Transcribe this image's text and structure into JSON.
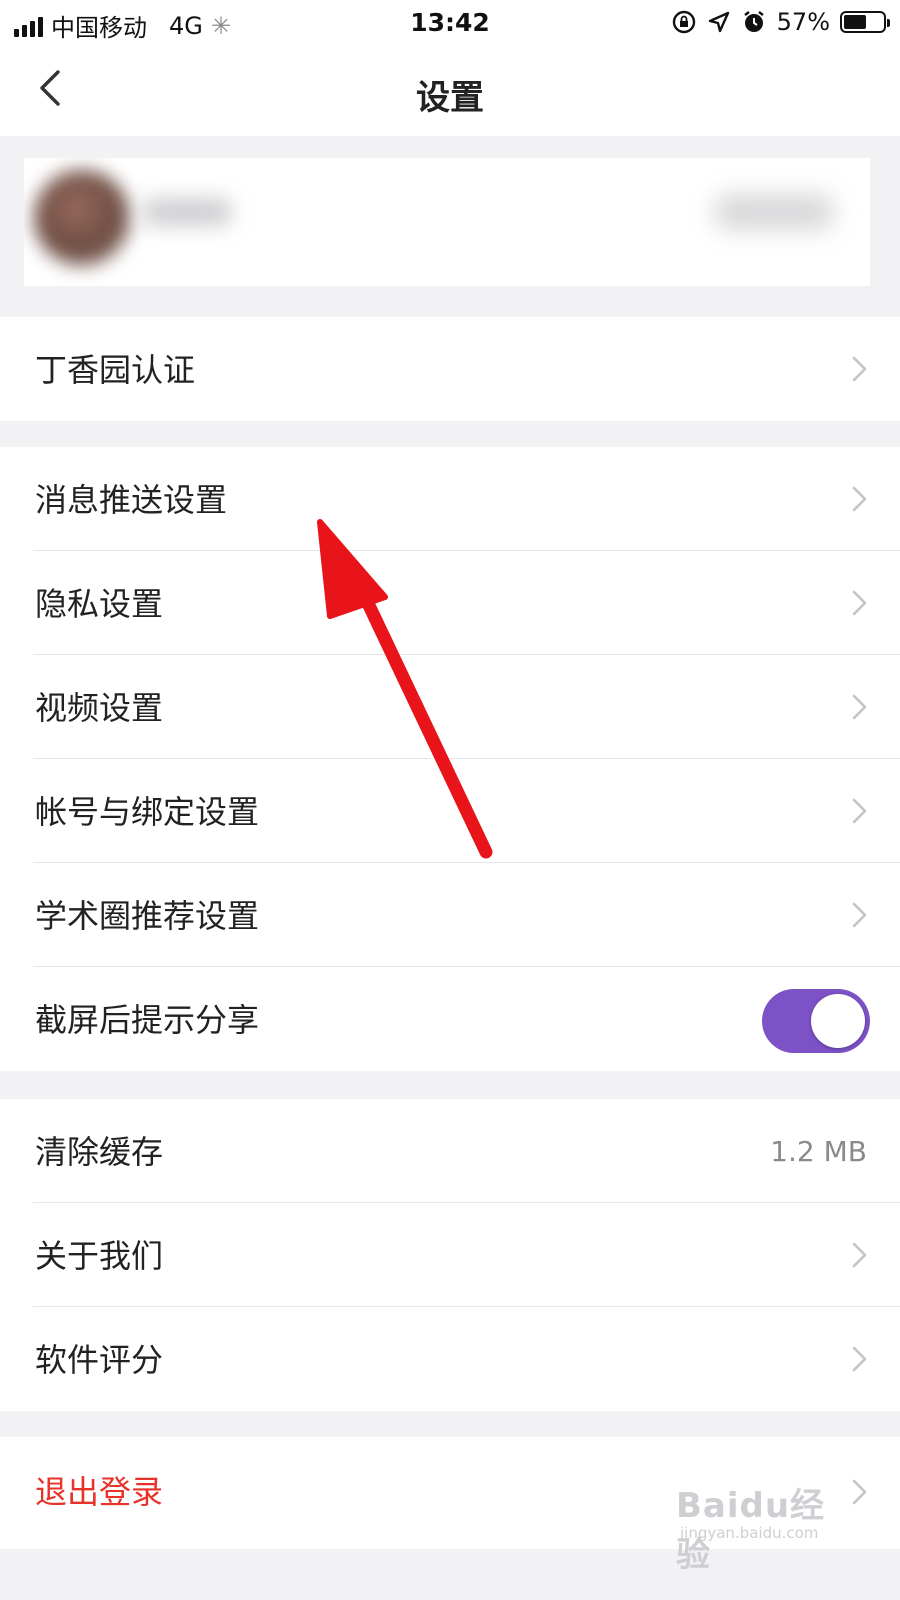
{
  "status_bar": {
    "carrier": "中国移动",
    "network": "4G",
    "time": "13:42",
    "battery_percent": "57%",
    "battery_level": 0.57,
    "icons": [
      "signal-icon",
      "loading-icon",
      "orientation-lock-icon",
      "location-icon",
      "alarm-icon",
      "battery-icon"
    ]
  },
  "nav": {
    "title": "设置",
    "back_icon": "chevron-left-icon"
  },
  "groups": {
    "certification": {
      "item": "丁香园认证"
    },
    "settings": {
      "push": "消息推送设置",
      "privacy": "隐私设置",
      "video": "视频设置",
      "account": "帐号与绑定设置",
      "academic": "学术圈推荐设置",
      "screenshot_share": "截屏后提示分享",
      "screenshot_share_on": true
    },
    "misc": {
      "clear_cache": "清除缓存",
      "cache_size": "1.2 MB",
      "about": "关于我们",
      "rate": "软件评分"
    },
    "logout": {
      "label": "退出登录"
    }
  },
  "colors": {
    "accent": "#7c52c6",
    "danger": "#e8332a",
    "annotation_arrow": "#e8141a"
  },
  "watermark": {
    "brand": "Baidu经验",
    "url": "jingyan.baidu.com"
  }
}
